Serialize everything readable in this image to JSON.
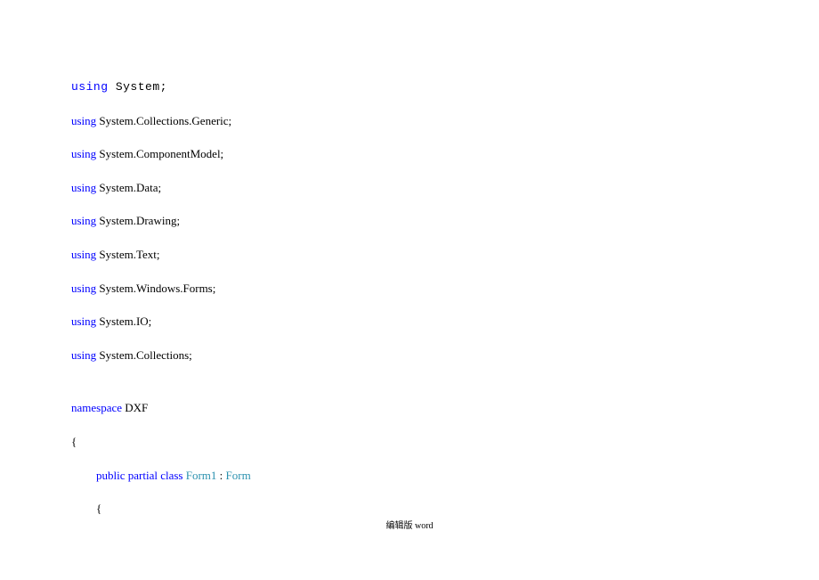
{
  "code": {
    "lines": [
      {
        "kw": "using",
        "rest": " System;",
        "mono": true
      },
      {
        "kw": "using",
        "rest": " System.Collections.Generic;"
      },
      {
        "kw": "using",
        "rest": " System.ComponentModel;"
      },
      {
        "kw": "using",
        "rest": " System.Data;"
      },
      {
        "kw": "using",
        "rest": " System.Drawing;"
      },
      {
        "kw": "using",
        "rest": " System.Text;"
      },
      {
        "kw": "using",
        "rest": " System.Windows.Forms;"
      },
      {
        "kw": "using",
        "rest": " System.IO;"
      },
      {
        "kw": "using",
        "rest": " System.Collections;"
      }
    ],
    "namespace_kw": "namespace",
    "namespace_name": " DXF",
    "brace_open": "{",
    "class_kw1": "public",
    "class_kw2": " partial",
    "class_kw3": " class",
    "class_name": " Form1",
    "class_colon": " : ",
    "class_base": "Form",
    "brace_open2": "{"
  },
  "footer": "编辑版 word"
}
